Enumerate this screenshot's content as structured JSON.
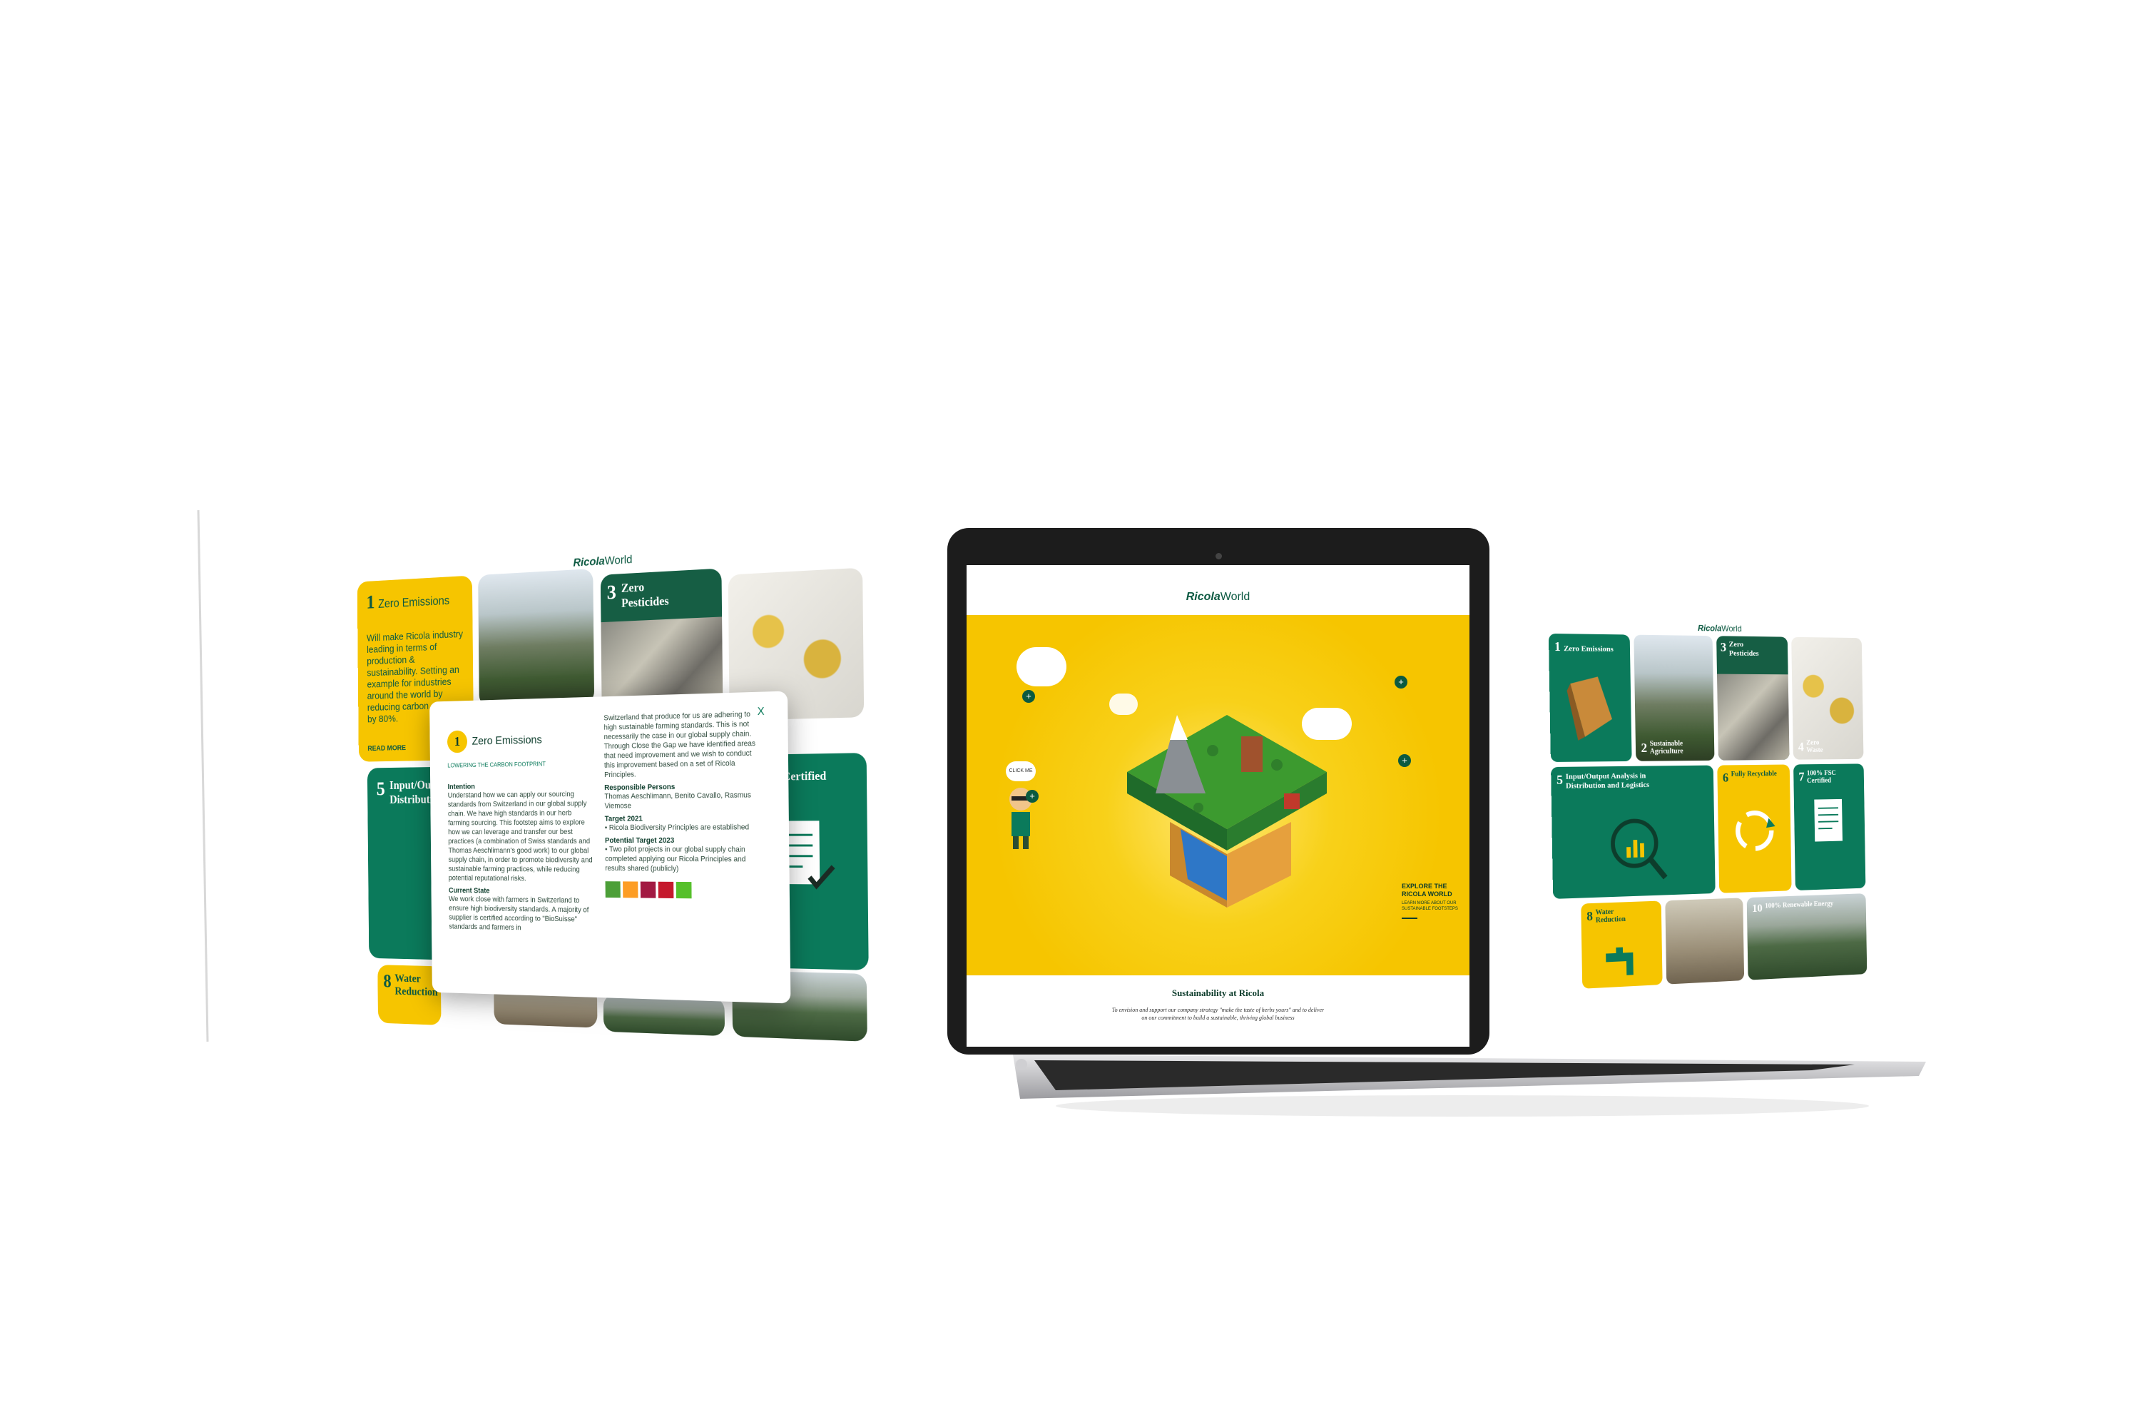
{
  "brand": {
    "logo_main": "Ricola",
    "logo_sub": "World"
  },
  "colors": {
    "brand_yellow": "#f6c500",
    "brand_green": "#0b7a5b",
    "dark_green": "#165e44"
  },
  "left_screen": {
    "tile1": {
      "number": "1",
      "title": "Zero Emissions",
      "body": "Will make Ricola industry leading in terms of production & sustainability. Setting an example for industries around the world by reducing carbon output by 80%.",
      "link": "READ MORE"
    },
    "tile3": {
      "number": "3",
      "title": "Zero Pesticides"
    },
    "tile5": {
      "number": "5",
      "title": "Input/Output Analysis in Distribution and Logistics",
      "title_visible": "Input/Out Distributi"
    },
    "tile7": {
      "title_visible": "SC Certified"
    },
    "tile8": {
      "number": "8",
      "title": "Water Reduction"
    },
    "popup": {
      "close": "X",
      "number": "1",
      "title": "Zero Emissions",
      "subtitle": "LOWERING THE CARBON FOOTPRINT",
      "intention_heading": "Intention",
      "intention_text": "Understand how we can apply our sourcing standards from Switzerland in our global supply chain. We have high standards in our herb farming sourcing. This footstep aims to explore how we can leverage and transfer our best practices (a combination of Swiss standards and Thomas Aeschlimann's good work) to our global supply chain, in order to promote biodiversity and sustainable farming practices, while reducing potential reputational risks.",
      "current_heading": "Current State",
      "current_text": "We work close with farmers in Switzerland to ensure high biodiversity standards. A majority of supplier is certified according to \"BioSuisse\" standards and farmers in",
      "col2_text": "Switzerland that produce for us are adhering to high sustainable farming standards. This is not necessarily the case in our global supply chain. Through Close the Gap we have identified areas that need improvement and we wish to conduct this improvement based on a set of Ricola Principles.",
      "persons_heading": "Responsible Persons",
      "persons_text": "Thomas Aeschlimann, Benito Cavallo, Rasmus Viemose",
      "target_heading": "Target 2021",
      "target_text": "• Ricola Biodiversity Principles are established",
      "potential_heading": "Potential Target 2023",
      "potential_text": "• Two pilot projects in our global supply chain completed applying our Ricola Principles and results shared (publicly)",
      "sdg_badges": [
        "#4c9f38",
        "#fd9d24",
        "#a21942",
        "#c5192d",
        "#56c02b"
      ]
    }
  },
  "laptop": {
    "click_me": "CLICK ME",
    "explore_title": "EXPLORE THE RICOLA WORLD",
    "explore_sub": "LEARN MORE ABOUT OUR SUSTAINABLE FOOTSTEPS",
    "plus": "+",
    "caption_title": "Sustainability at Ricola",
    "caption_text": "To envision and support our company strategy \"make the taste of herbs yours\" and to deliver on our commitment to build a sustainable, thriving global business"
  },
  "right_screen": {
    "tile1": {
      "number": "1",
      "title": "Zero Emissions"
    },
    "tile2": {
      "number": "2",
      "title": "Sustainable Agriculture"
    },
    "tile3": {
      "number": "3",
      "title": "Zero Pesticides"
    },
    "tile4": {
      "number": "4",
      "title": "Zero Waste"
    },
    "tile5": {
      "number": "5",
      "title": "Input/Output Analysis in Distribution and Logistics"
    },
    "tile6": {
      "number": "6",
      "title": "Fully Recyclable"
    },
    "tile7": {
      "number": "7",
      "title": "100% FSC Certified"
    },
    "tile8": {
      "number": "8",
      "title": "Water Reduction"
    },
    "tile10": {
      "number": "10",
      "title": "100% Renewable Energy"
    }
  }
}
